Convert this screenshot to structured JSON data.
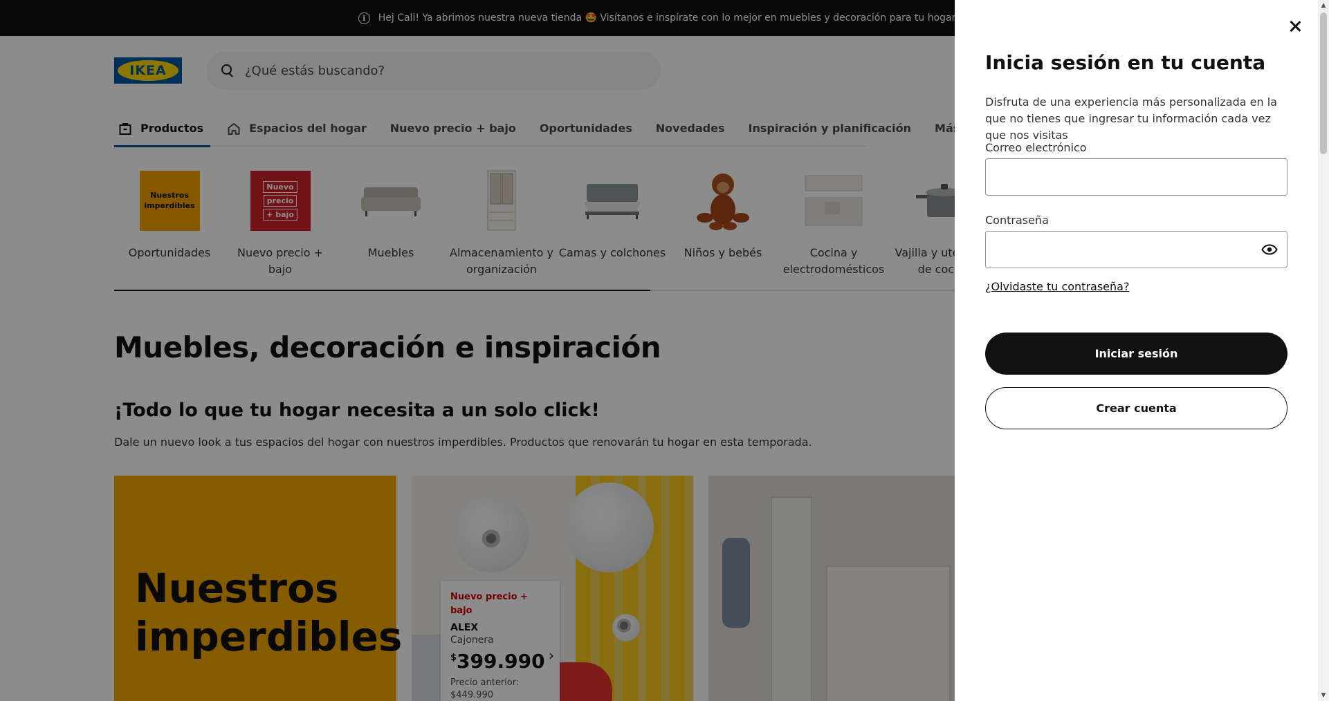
{
  "announcement": {
    "text": "Hej Cali! Ya abrimos nuestra nueva tienda 🤩 Visítanos e inspírate con lo mejor en muebles y decoración para tu hogar 🏠"
  },
  "brand": {
    "logo_text": "IKEA",
    "logo_blue": "#0058a3",
    "logo_yellow": "#ffdb00"
  },
  "search": {
    "placeholder": "¿Qué estás buscando?"
  },
  "nav": {
    "tabs": [
      {
        "label": "Productos",
        "icon": "shopping-bag-icon",
        "active": true
      },
      {
        "label": "Espacios del hogar",
        "icon": "home-icon"
      },
      {
        "label": "Nuevo precio + bajo"
      },
      {
        "label": "Oportunidades"
      },
      {
        "label": "Novedades"
      },
      {
        "label": "Inspiración y planificación"
      },
      {
        "label": "Más"
      }
    ]
  },
  "categories": [
    {
      "label": "Oportunidades",
      "thumb_text": "Nuestros imperdibles"
    },
    {
      "label": "Nuevo precio + bajo",
      "thumb_lines": [
        "Nuevo",
        "precio",
        "+ bajo"
      ]
    },
    {
      "label": "Muebles"
    },
    {
      "label": "Almacenamiento y organización"
    },
    {
      "label": "Camas y colchones"
    },
    {
      "label": "Niños y bebés"
    },
    {
      "label": "Cocina y electrodomésticos"
    },
    {
      "label": "Vajilla y utensilios de cocina"
    }
  ],
  "categories_scroll_progress": 0.63,
  "main": {
    "heading": "Muebles, decoración e inspiración",
    "subheading": "¡Todo lo que tu hogar necesita a un solo click!",
    "lead": "Dale un nuevo look a tus espacios del hogar con nuestros imperdibles. Productos que renovarán tu hogar en esta temporada."
  },
  "cards": {
    "promo_title": "Nuestros imperdibles",
    "product": {
      "tag": "Nuevo precio + bajo",
      "name": "ALEX",
      "type": "Cajonera",
      "currency": "$",
      "price": "399.990",
      "previous_label": "Precio anterior:",
      "previous_price": "$449.990"
    }
  },
  "login_modal": {
    "title": "Inicia sesión en tu cuenta",
    "description": "Disfruta de una experiencia más personalizada en la que no tienes que ingresar tu información cada vez que nos visitas",
    "email_label": "Correo electrónico",
    "email_value": "",
    "password_label": "Contraseña",
    "password_value": "",
    "forgot_link": "¿Olvidaste tu contraseña?",
    "primary_button": "Iniciar sesión",
    "secondary_button": "Crear cuenta"
  },
  "colors": {
    "topbar": "#111111",
    "nav_active_underline": "#0058a3",
    "deal_yellow": "#f5a800",
    "deal_red": "#cc0008",
    "button_primary": "#111111"
  }
}
